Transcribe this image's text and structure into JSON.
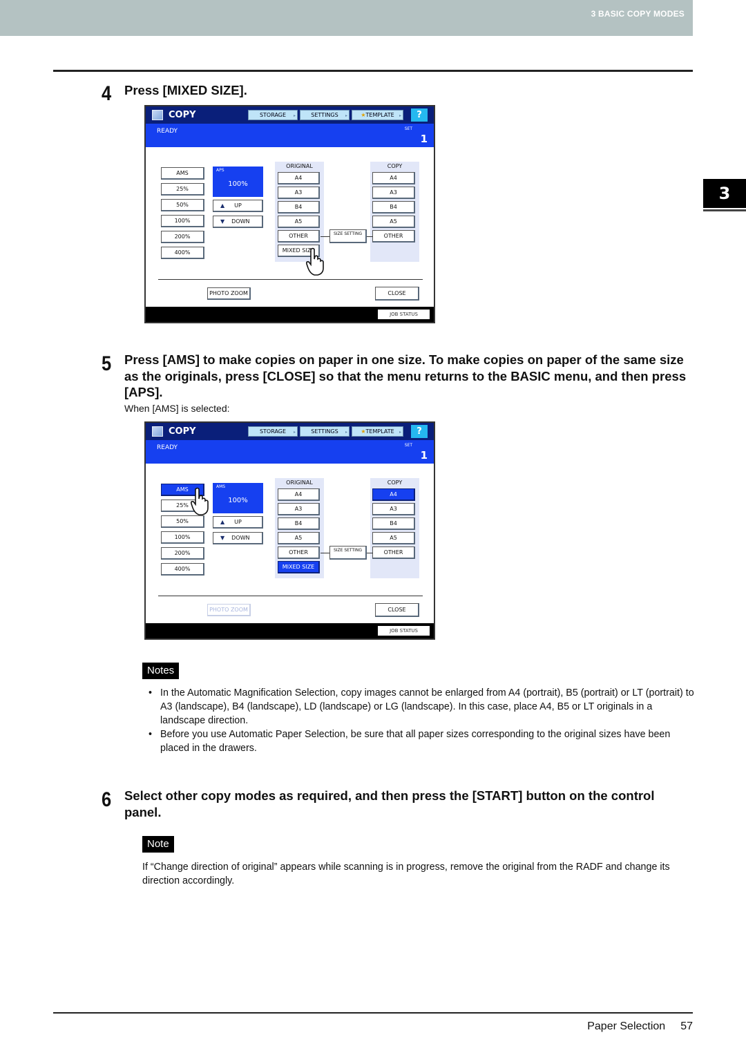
{
  "header": {
    "chapter_label": "3 BASIC COPY MODES"
  },
  "chapter_tab": "3",
  "steps": [
    {
      "number": "4",
      "text": "Press [MIXED SIZE]."
    },
    {
      "number": "5",
      "text": "Press [AMS] to make copies on paper in one size. To make copies on paper of the same size as the originals, press [CLOSE] so that the menu returns to the BASIC menu, and then press [APS].",
      "caption": "When [AMS] is selected:"
    },
    {
      "number": "6",
      "text": "Select other copy modes as required, and then press the [START] button on the control panel."
    }
  ],
  "screens": [
    {
      "title": "COPY",
      "top_buttons": [
        "STORAGE",
        "SETTINGS",
        "TEMPLATE"
      ],
      "help": "?",
      "status": "READY",
      "set_label": "SET",
      "set_count": "1",
      "ratio_buttons": [
        "AMS",
        "25%",
        "50%",
        "100%",
        "200%",
        "400%"
      ],
      "zoom_mode": "APS",
      "zoom_value": "100%",
      "up_label": "UP",
      "down_label": "DOWN",
      "original_title": "ORIGINAL",
      "original_sizes": [
        "A4",
        "A3",
        "B4",
        "A5",
        "OTHER",
        "MIXED SIZE"
      ],
      "copy_title": "COPY",
      "copy_sizes": [
        "A4",
        "A3",
        "B4",
        "A5",
        "OTHER"
      ],
      "size_setting": "SIZE SETTING",
      "photo_zoom": "PHOTO ZOOM",
      "close": "CLOSE",
      "jobs": "JOB STATUS",
      "selected": {
        "ratio": null,
        "original": null,
        "copy": null
      },
      "pointer_on": "MIXED SIZE"
    },
    {
      "title": "COPY",
      "top_buttons": [
        "STORAGE",
        "SETTINGS",
        "TEMPLATE"
      ],
      "help": "?",
      "status": "READY",
      "set_label": "SET",
      "set_count": "1",
      "ratio_buttons": [
        "AMS",
        "25%",
        "50%",
        "100%",
        "200%",
        "400%"
      ],
      "zoom_mode": "AMS",
      "zoom_value": "100%",
      "up_label": "UP",
      "down_label": "DOWN",
      "original_title": "ORIGINAL",
      "original_sizes": [
        "A4",
        "A3",
        "B4",
        "A5",
        "OTHER",
        "MIXED SIZE"
      ],
      "copy_title": "COPY",
      "copy_sizes": [
        "A4",
        "A3",
        "B4",
        "A5",
        "OTHER"
      ],
      "size_setting": "SIZE SETTING",
      "photo_zoom": "PHOTO ZOOM",
      "close": "CLOSE",
      "jobs": "JOB STATUS",
      "selected": {
        "ratio": "AMS",
        "original": "MIXED SIZE",
        "copy": "A4"
      },
      "pointer_on": "AMS"
    }
  ],
  "notes": {
    "label": "Notes",
    "items": [
      "In the Automatic Magnification Selection, copy images cannot be enlarged from A4 (portrait), B5 (portrait) or LT (portrait) to A3 (landscape), B4 (landscape), LD (landscape) or LG (landscape). In this case, place A4, B5 or LT originals in a landscape direction.",
      "Before you use Automatic Paper Selection, be sure that all paper sizes corresponding to the original sizes have been placed in the drawers."
    ]
  },
  "note": {
    "label": "Note",
    "text": "If “Change direction of original” appears while scanning is in progress, remove the original from the RADF and change its direction accordingly."
  },
  "footer": {
    "section": "Paper Selection",
    "page": "57"
  },
  "colors": {
    "screen_header": "#0a1f7a",
    "screen_status": "#1640f0",
    "help_button": "#25b8f0",
    "panel_bg": "#e2e7f8"
  }
}
